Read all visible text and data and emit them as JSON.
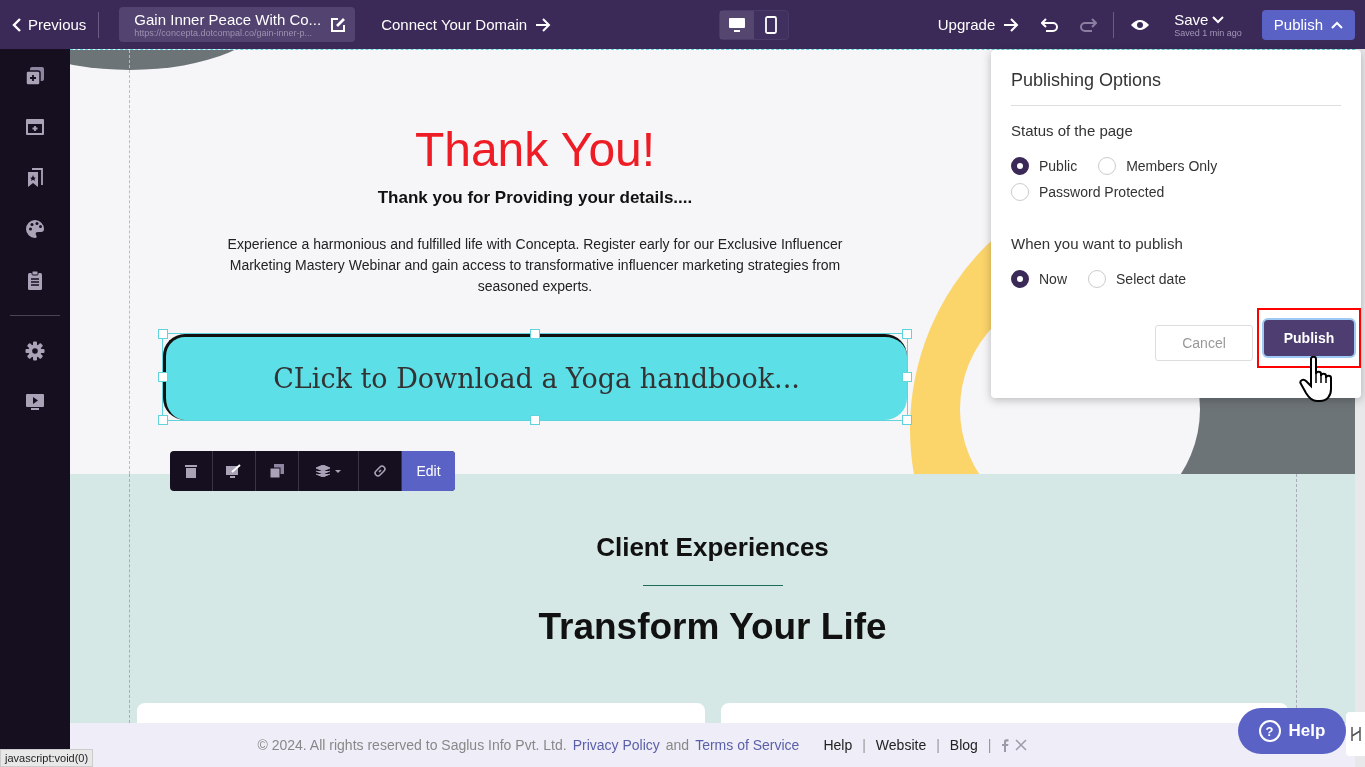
{
  "topbar": {
    "previous": "Previous",
    "page_title": "Gain Inner Peace With Co...",
    "page_url": "https://concepta.dotcompal.co/gain-inner-p...",
    "connect_domain": "Connect Your Domain",
    "devices": [
      {
        "kind": "desktop",
        "selected": true
      },
      {
        "kind": "mobile",
        "selected": false
      }
    ],
    "upgrade": "Upgrade",
    "save": "Save",
    "saved_status": "Saved 1 min ago",
    "publish": "Publish"
  },
  "hero": {
    "heading": "Thank You!",
    "subheading": "Thank you for Providing your details....",
    "body": "Experience a harmonious and fulfilled life with Concepta. Register early for our Exclusive Influencer Marketing Mastery Webinar and gain access to transformative influencer marketing strategies from seasoned experts.",
    "cta": "CLick to Download a Yoga handbook..."
  },
  "element_toolbar": {
    "edit": "Edit"
  },
  "section": {
    "title": "Client Experiences",
    "heading": "Transform Your Life"
  },
  "footer": {
    "copyright": "©  2024. All rights reserved to Saglus Info Pvt. Ltd.",
    "privacy": "Privacy Policy",
    "and": "and",
    "terms": "Terms of Service",
    "links": [
      "Help",
      "Website",
      "Blog"
    ],
    "separator": "|"
  },
  "publishing_options": {
    "title": "Publishing Options",
    "status_label": "Status of the page",
    "status_options": [
      {
        "label": "Public",
        "selected": true
      },
      {
        "label": "Members Only",
        "selected": false
      },
      {
        "label": "Password Protected",
        "selected": false
      }
    ],
    "when_label": "When you want to publish",
    "when_options": [
      {
        "label": "Now",
        "selected": true
      },
      {
        "label": "Select date",
        "selected": false
      }
    ],
    "cancel": "Cancel",
    "publish": "Publish"
  },
  "help": {
    "icon": "?",
    "label": "Help"
  },
  "status_url": "javascript:void(0)"
}
